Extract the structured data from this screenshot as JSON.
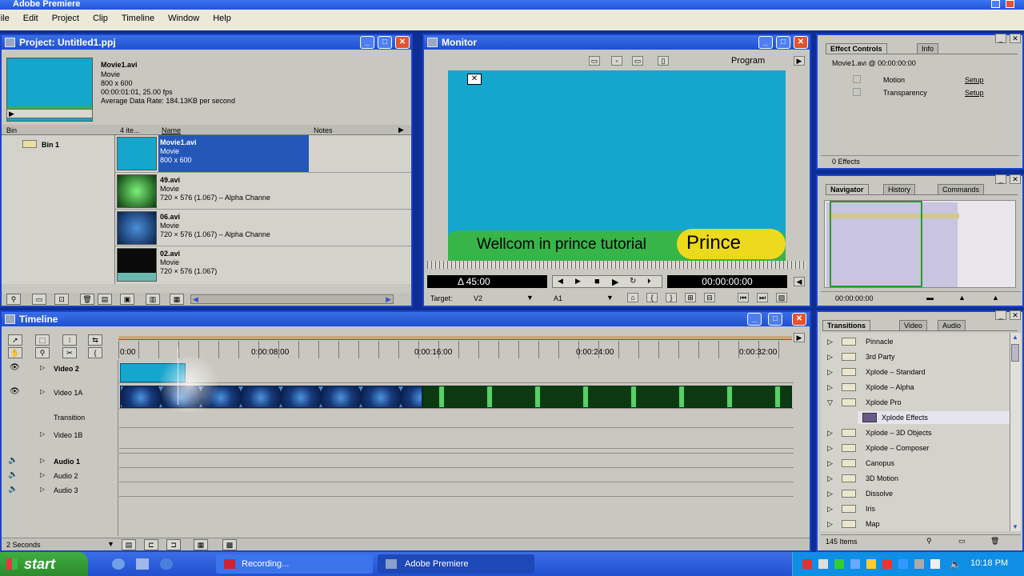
{
  "app": {
    "title": "Adobe Premiere"
  },
  "menu": [
    "File",
    "Edit",
    "Project",
    "Clip",
    "Timeline",
    "Window",
    "Help"
  ],
  "project": {
    "title": "Project: Untitled1.ppj",
    "preview": {
      "name": "Movie1.avi",
      "type": "Movie",
      "size": "800 x 600",
      "duration": "00:00:01:01, 25.00 fps",
      "rate": "Average Data Rate: 184.13KB per second"
    },
    "columns": {
      "bin": "Bin",
      "count": "4 ite...",
      "name": "Name",
      "notes": "Notes"
    },
    "bin": "Bin 1",
    "items": [
      {
        "name": "Movie1.avi",
        "type": "Movie",
        "info": "800 x 600"
      },
      {
        "name": "49.avi",
        "type": "Movie",
        "info": "720 × 576 (1.067) – Alpha Channe"
      },
      {
        "name": "06.avi",
        "type": "Movie",
        "info": "720 × 576 (1.067) – Alpha Channe"
      },
      {
        "name": "02.avi",
        "type": "Movie",
        "info": "720 × 576 (1.067)"
      }
    ]
  },
  "monitor": {
    "title": "Monitor",
    "view": "Program",
    "caption": "Wellcom in prince tutorial",
    "badge": "Prince",
    "duration": "Δ 45:00",
    "timecode": "00:00:00:00",
    "target_label": "Target:",
    "target_video": "V2",
    "target_audio": "A1"
  },
  "effect_controls": {
    "tabs": [
      "Effect Controls",
      "Info"
    ],
    "clip": "Movie1.avi @ 00:00:00:00",
    "effects": [
      {
        "name": "Motion",
        "link": "Setup"
      },
      {
        "name": "Transparency",
        "link": "Setup"
      }
    ],
    "count": "0 Effects"
  },
  "navigator": {
    "tabs": [
      "Navigator",
      "History",
      "Commands"
    ],
    "timecode": "00:00:00:00"
  },
  "timeline": {
    "title": "Timeline",
    "ruler": [
      "0:00",
      "0:00:08:00",
      "0:00:16:00",
      "0:00:24:00",
      "0:00:32:00"
    ],
    "tracks": [
      "Video 2",
      "Video 1A",
      "Transition",
      "Video 1B",
      "Audio 1",
      "Audio 2",
      "Audio 3"
    ],
    "zoom": "2 Seconds"
  },
  "transitions": {
    "tabs": [
      "Transitions",
      "Video",
      "Audio"
    ],
    "items": [
      "Pinnacle",
      "3rd Party",
      "Xplode – Standard",
      "Xplode – Alpha",
      "Xplode Pro",
      "Xplode Effects",
      "Xplode – 3D Objects",
      "Xplode – Composer",
      "Canopus",
      "3D Motion",
      "Dissolve",
      "Iris",
      "Map"
    ],
    "count": "145 Items"
  },
  "taskbar": {
    "start": "start",
    "tasks": [
      "Recording...",
      "Adobe Premiere"
    ],
    "clock": "10:18 PM"
  }
}
